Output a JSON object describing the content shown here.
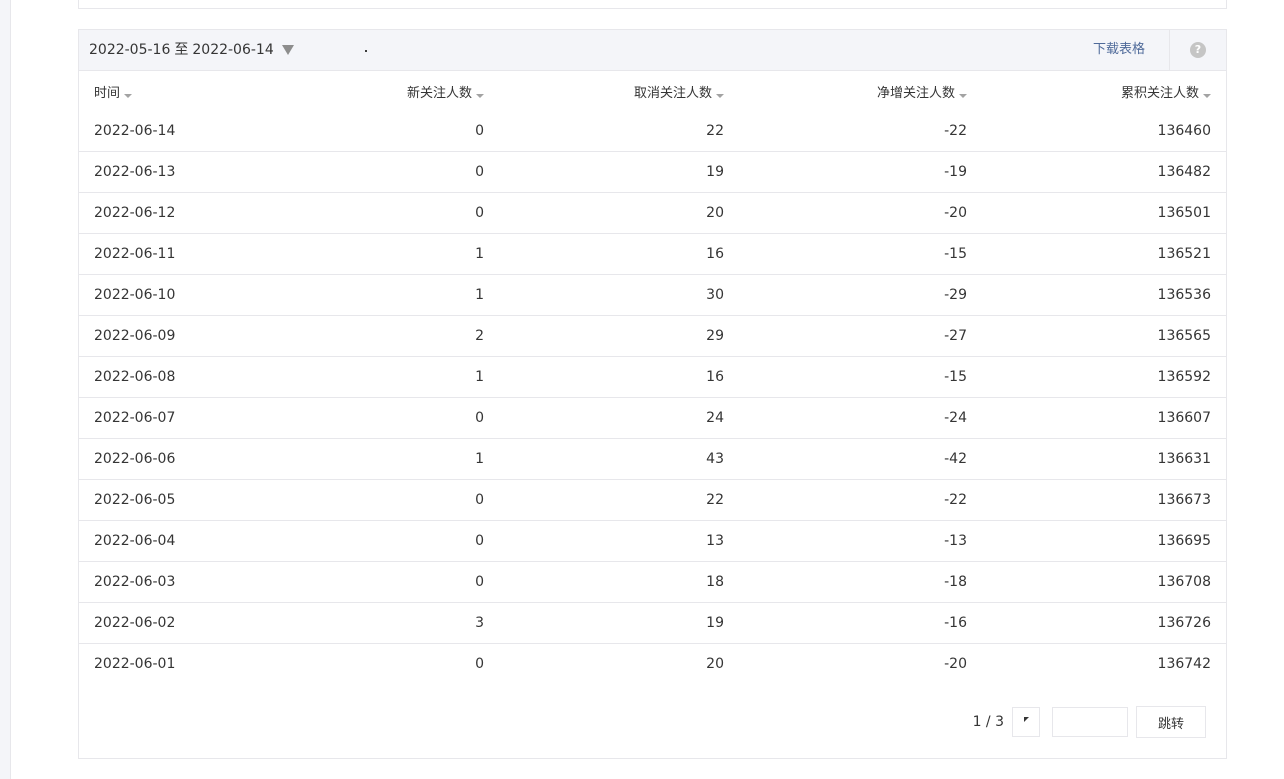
{
  "toolbar": {
    "date_start": "2022-05-16",
    "date_sep": "至",
    "date_end": "2022-06-14",
    "download_label": "下载表格",
    "help_glyph": "?"
  },
  "table": {
    "columns": [
      "时间",
      "新关注人数",
      "取消关注人数",
      "净增关注人数",
      "累积关注人数"
    ],
    "rows": [
      [
        "2022-06-14",
        "0",
        "22",
        "-22",
        "136460"
      ],
      [
        "2022-06-13",
        "0",
        "19",
        "-19",
        "136482"
      ],
      [
        "2022-06-12",
        "0",
        "20",
        "-20",
        "136501"
      ],
      [
        "2022-06-11",
        "1",
        "16",
        "-15",
        "136521"
      ],
      [
        "2022-06-10",
        "1",
        "30",
        "-29",
        "136536"
      ],
      [
        "2022-06-09",
        "2",
        "29",
        "-27",
        "136565"
      ],
      [
        "2022-06-08",
        "1",
        "16",
        "-15",
        "136592"
      ],
      [
        "2022-06-07",
        "0",
        "24",
        "-24",
        "136607"
      ],
      [
        "2022-06-06",
        "1",
        "43",
        "-42",
        "136631"
      ],
      [
        "2022-06-05",
        "0",
        "22",
        "-22",
        "136673"
      ],
      [
        "2022-06-04",
        "0",
        "13",
        "-13",
        "136695"
      ],
      [
        "2022-06-03",
        "0",
        "18",
        "-18",
        "136708"
      ],
      [
        "2022-06-02",
        "3",
        "19",
        "-16",
        "136726"
      ],
      [
        "2022-06-01",
        "0",
        "20",
        "-20",
        "136742"
      ]
    ]
  },
  "pager": {
    "page_info": "1 / 3",
    "jump_label": "跳转",
    "input_value": ""
  },
  "icons": {
    "date_dropdown": "caret-down-icon",
    "sort": "sort-caret-icon",
    "next": "next-page-icon",
    "help": "help-icon"
  },
  "colors": {
    "toolbar_bg": "#f4f5f9",
    "link": "#4f6a9a",
    "border": "#e7e7eb",
    "text": "#353535"
  }
}
